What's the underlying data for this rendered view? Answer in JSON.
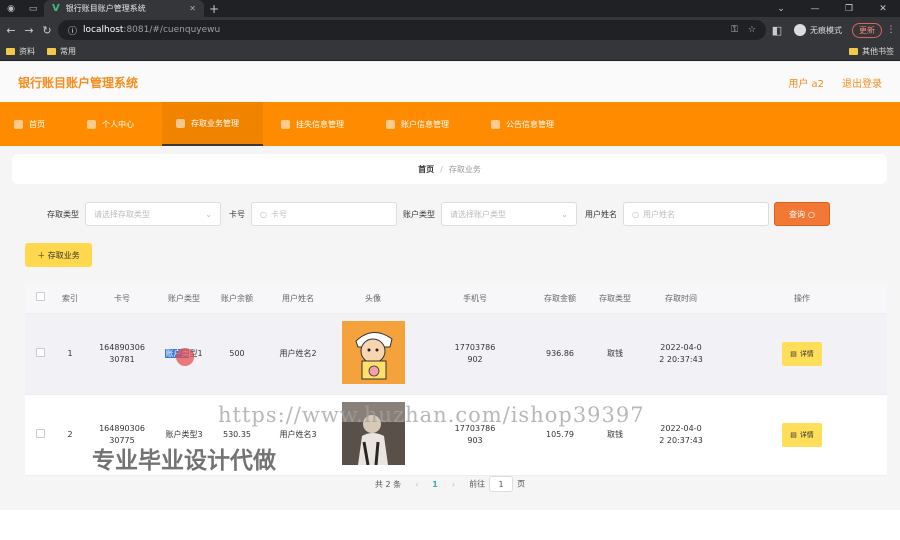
{
  "browser": {
    "tab_title": "银行账目账户管理系统",
    "url_host": "localhost",
    "url_path": ":8081/#/cuenquyewu",
    "incognito_label": "无痕模式",
    "update_label": "更新",
    "bookmarks": [
      "资料",
      "常用"
    ],
    "bookmarks_right": "其他书签"
  },
  "app": {
    "title": "银行账目账户管理系统",
    "user_label": "用户 a2",
    "logout_label": "退出登录"
  },
  "nav": {
    "items": [
      "首页",
      "个人中心",
      "存取业务管理",
      "挂失信息管理",
      "账户信息管理",
      "公告信息管理"
    ]
  },
  "breadcrumb": {
    "home": "首页",
    "sep": "/",
    "current": "存取业务"
  },
  "filters": {
    "type_label": "存取类型",
    "type_placeholder": "请选择存取类型",
    "card_label": "卡号",
    "card_placeholder": "卡号",
    "account_type_label": "账户类型",
    "account_type_placeholder": "请选择账户类型",
    "user_name_label": "用户姓名",
    "user_name_placeholder": "用户姓名",
    "query_label": "查询"
  },
  "add_button_label": "＋ 存取业务",
  "table": {
    "headers": [
      "索引",
      "卡号",
      "账户类型",
      "账户余额",
      "用户姓名",
      "头像",
      "手机号",
      "存取金额",
      "存取类型",
      "存取时间",
      "操作"
    ],
    "rows": [
      {
        "index": "1",
        "card_a": "164890306",
        "card_b": "30781",
        "account_type_hl": "账户类",
        "account_type_rest": "型1",
        "balance": "500",
        "user_name": "用户姓名2",
        "phone_a": "17703786",
        "phone_b": "902",
        "amount": "936.86",
        "op_type": "取钱",
        "time_a": "2022-04-0",
        "time_b": "2 20:37:43",
        "action": "详情"
      },
      {
        "index": "2",
        "card_a": "164890306",
        "card_b": "30775",
        "account_type": "账户类型3",
        "balance": "530.35",
        "user_name": "用户姓名3",
        "phone_a": "17703786",
        "phone_b": "903",
        "amount": "105.79",
        "op_type": "取钱",
        "time_a": "2022-04-0",
        "time_b": "2 20:37:43",
        "action": "详情"
      }
    ]
  },
  "pager": {
    "total": "共 2 条",
    "current": "1",
    "goto_label": "前往",
    "goto_value": "1",
    "page_suffix": "页"
  },
  "watermark": {
    "url": "https://www.huzhan.com/ishop39397",
    "slogan": "专业毕业设计代做"
  },
  "colors": {
    "brand": "#ff8c00",
    "title": "#f38e1f",
    "query": "#f27935",
    "add": "#ffd84d"
  }
}
